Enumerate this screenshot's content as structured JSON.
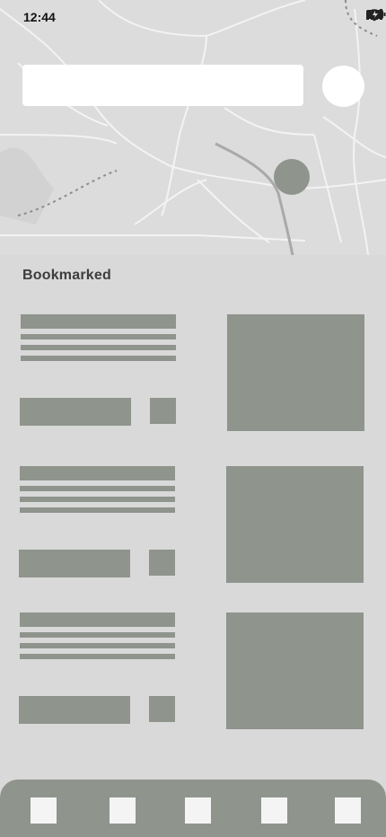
{
  "status_bar": {
    "time": "12:44",
    "icons": [
      "signal-icon",
      "wifi-icon",
      "battery-icon"
    ]
  },
  "search": {
    "value": "",
    "placeholder": ""
  },
  "section": {
    "title": "Bookmarked"
  },
  "bookmarks": [
    {
      "id": 1
    },
    {
      "id": 2
    },
    {
      "id": 3
    }
  ],
  "tabbar": {
    "tabs": [
      "tab-1",
      "tab-2",
      "tab-3",
      "tab-4",
      "tab-5"
    ]
  },
  "colors": {
    "background": "#d9d9d9",
    "placeholder_block": "#8f948d",
    "map_road": "#f2f2f2",
    "map_water": "#a9a9a9"
  }
}
